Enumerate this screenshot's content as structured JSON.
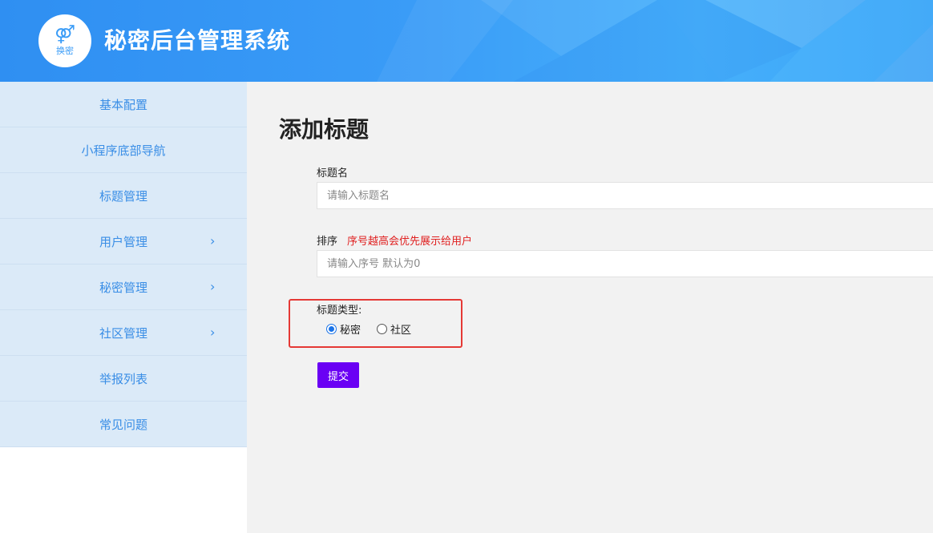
{
  "header": {
    "logo_symbol": "⚤",
    "logo_text": "换密",
    "app_title": "秘密后台管理系统"
  },
  "sidebar": {
    "items": [
      {
        "label": "基本配置",
        "has_submenu": false
      },
      {
        "label": "小程序底部导航",
        "has_submenu": false
      },
      {
        "label": "标题管理",
        "has_submenu": false
      },
      {
        "label": "用户管理",
        "has_submenu": true
      },
      {
        "label": "秘密管理",
        "has_submenu": true
      },
      {
        "label": "社区管理",
        "has_submenu": true
      },
      {
        "label": "举报列表",
        "has_submenu": false
      },
      {
        "label": "常见问题",
        "has_submenu": false
      }
    ],
    "chevron": "›"
  },
  "main": {
    "page_title": "添加标题",
    "title_name": {
      "label": "标题名",
      "placeholder": "请输入标题名"
    },
    "sort": {
      "label": "排序",
      "hint": "序号越高会优先展示给用户",
      "placeholder": "请输入序号 默认为0"
    },
    "title_type": {
      "label": "标题类型:",
      "options": [
        {
          "label": "秘密",
          "checked": true
        },
        {
          "label": "社区",
          "checked": false
        }
      ]
    },
    "submit_label": "提交"
  },
  "colors": {
    "header_blue": "#3a9cf7",
    "sidebar_bg": "#dbeaf8",
    "sidebar_text": "#3a8ee6",
    "hint_red": "#e02020",
    "highlight_red": "#e53935",
    "submit_purple": "#6a00f4"
  }
}
